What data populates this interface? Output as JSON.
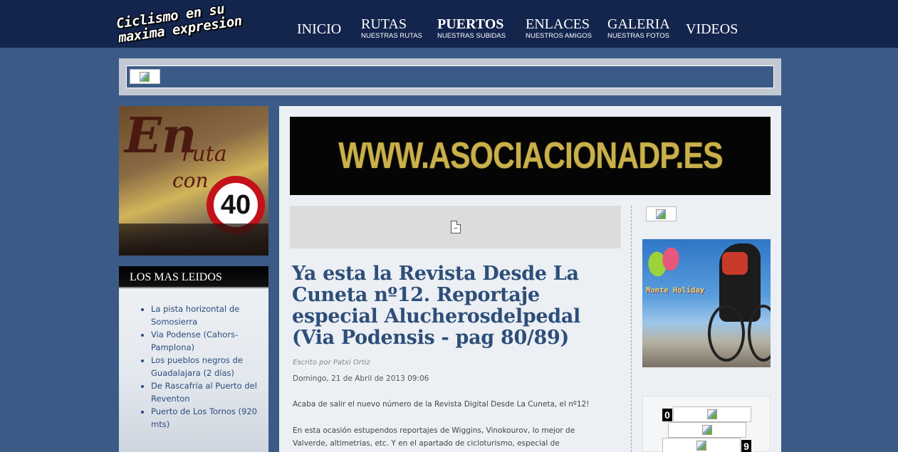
{
  "site": {
    "logo_line1": "Ciclismo en su",
    "logo_line2": "maxima expresion"
  },
  "nav": [
    {
      "label": "INICIO",
      "sub": ""
    },
    {
      "label": "RUTAS",
      "sub": "NUESTRAS RUTAS"
    },
    {
      "label": "PUERTOS",
      "sub": "NUESTRAS SUBIDAS"
    },
    {
      "label": "ENLACES",
      "sub": "NUESTROS AMIGOS"
    },
    {
      "label": "GALERIA",
      "sub": "NUESTRAS FOTOS"
    },
    {
      "label": "VIDEOS",
      "sub": ""
    }
  ],
  "left_image": {
    "text_en": "En",
    "text_ruta": "ruta",
    "text_con": "con",
    "sign_value": "40"
  },
  "most_read": {
    "title": "LOS MAS LEIDOS",
    "items": [
      "La pista horizontal de Somosierra",
      "Via Podense (Cahors-Pamplona)",
      "Los pueblos negros de Guadalajara (2 días)",
      "De Rascafría al Puerto del Reventon",
      "Puerto de Los Tornos (920 mts)"
    ]
  },
  "banner": {
    "text": "WWW.ASOCIACIONADP.ES"
  },
  "article": {
    "title": "Ya esta la Revista Desde La Cuneta nº12. Reportaje especial Alucherosdelpedal (Via Podensis - pag 80/89)",
    "author": "Escrito por Patxi Ortiz",
    "date": "Domingo, 21 de Abril de 2013 09:06",
    "para1": "Acaba de salir el nuevo número de la Revista Digital Desde La Cuneta, el nº12!",
    "para2": "En esta ocasión estupendos reportajes de Wiggins, Vinokourov, lo mejor de Valverde, altimetrias, etc. Y en el apartado de cicloturismo, especial de"
  },
  "sidebar_ad": {
    "brand": "Monte Holiday"
  },
  "counter": {
    "digit_left": "0",
    "digit_right": "9"
  },
  "colors": {
    "page_bg": "#3b5b86",
    "header_bg": "#13244d",
    "title_blue": "#2d4e7a",
    "banner_gold": "#c9b04a"
  }
}
